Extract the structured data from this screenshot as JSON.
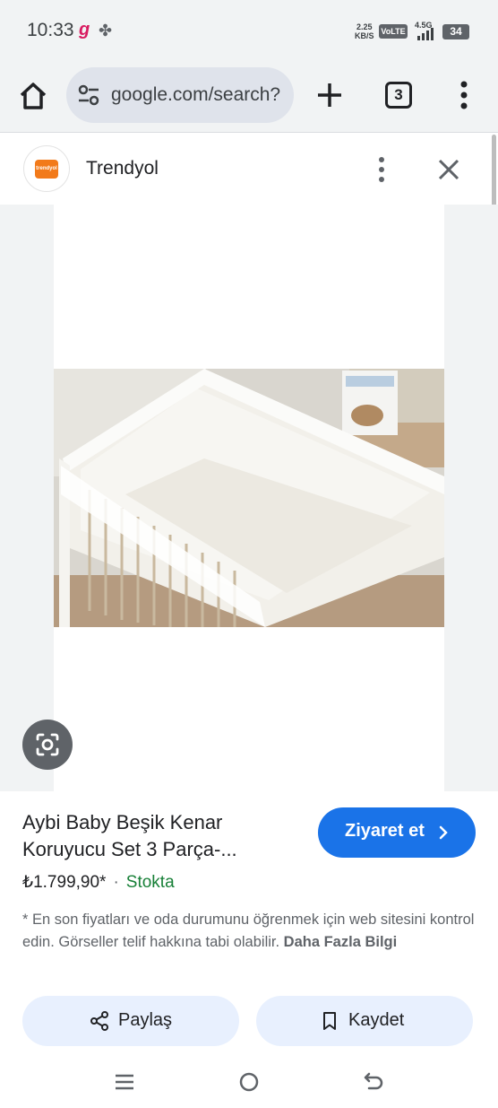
{
  "status_bar": {
    "time": "10:33",
    "app_glyph": "g",
    "speed_value": "2.25",
    "speed_unit": "KB/S",
    "volte": "VoLTE",
    "network": "4.5G",
    "battery": "34"
  },
  "toolbar": {
    "url": "google.com/search?",
    "tab_count": "3"
  },
  "sheet": {
    "site_name": "Trendyol",
    "logo_text": "trendyol"
  },
  "product": {
    "title": "Aybi Baby Beşik Kenar Koruyucu Set 3 Parça-...",
    "price": "₺1.799,90*",
    "separator": "·",
    "stock": "Stokta",
    "visit_label": "Ziyaret et",
    "disclaimer": "* En son fiyatları ve oda durumunu öğrenmek için web sitesini kontrol edin. Görseller telif hakkına tabi olabilir.",
    "more_info": "Daha Fazla Bilgi"
  },
  "actions": {
    "share_label": "Paylaş",
    "save_label": "Kaydet"
  },
  "colors": {
    "accent": "#1a73e8",
    "stock_green": "#188038",
    "brand_orange": "#f27a1a"
  },
  "icons": [
    "home-icon",
    "tune-icon",
    "plus-icon",
    "tab-switcher-icon",
    "more-vert-icon",
    "close-icon",
    "google-lens-icon",
    "share-icon",
    "bookmark-icon",
    "chevron-right-icon",
    "nav-recents-icon",
    "nav-home-icon",
    "nav-back-icon"
  ]
}
